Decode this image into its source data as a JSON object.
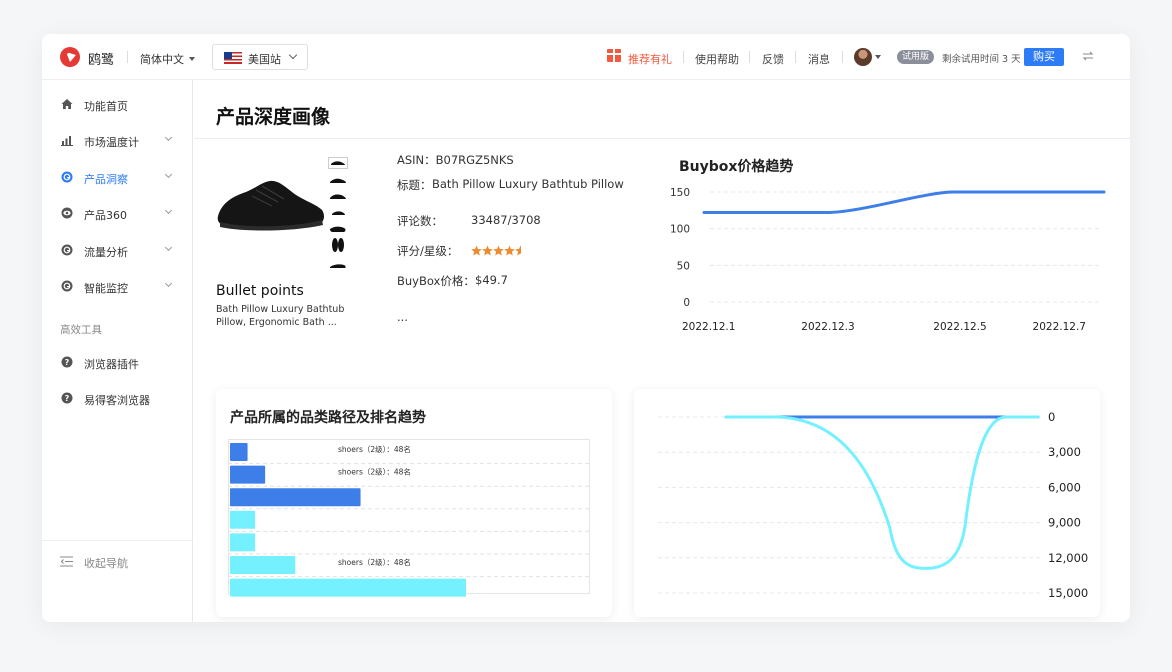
{
  "header": {
    "brand": "鸥鹭",
    "language": "简体中文",
    "site": "美国站",
    "recommend": "推荐有礼",
    "help": "使用帮助",
    "feedback": "反馈",
    "messages": "消息",
    "trial_badge": "试用版",
    "trial_remaining": "剩余试用时间 3 天",
    "buy": "购买"
  },
  "sidebar": {
    "items": [
      {
        "label": "功能首页",
        "icon": "home-icon"
      },
      {
        "label": "市场温度计",
        "icon": "bar-chart-icon"
      },
      {
        "label": "产品洞察",
        "icon": "insight-icon"
      },
      {
        "label": "产品360",
        "icon": "eye-icon"
      },
      {
        "label": "流量分析",
        "icon": "traffic-icon"
      },
      {
        "label": "智能监控",
        "icon": "monitor-icon"
      }
    ],
    "tools_label": "高效工具",
    "tools": [
      {
        "label": "浏览器插件",
        "icon": "help-icon"
      },
      {
        "label": "易得客浏览器",
        "icon": "help-icon"
      }
    ],
    "collapse": "收起导航"
  },
  "page": {
    "title": "产品深度画像"
  },
  "product": {
    "asin": "ASIN：B07RGZ5NKS",
    "title_label": "标题：",
    "title_value": "Bath Pillow Luxury Bathtub Pillow",
    "reviews_label": "评论数：",
    "reviews_value": "33487/3708",
    "rating_label": "评分/星级：",
    "rating_stars": 4.5,
    "buybox_label": "BuyBox价格：",
    "buybox_value": "$49.7",
    "ellipsis": "...",
    "bullet_title": "Bullet points",
    "bullet_text": "Bath Pillow Luxury Bathtub Pillow, Ergonomic Bath ..."
  },
  "colors": {
    "accent": "#2d7cf6",
    "line_blue": "#3d7ee8",
    "cyan": "#74f0ff",
    "star": "#f08a2e"
  },
  "chart_data": [
    {
      "type": "line",
      "title": "Buybox价格趋势",
      "x": [
        "2022.12.1",
        "2022.12.3",
        "2022.12.5",
        "2022.12.7"
      ],
      "y_ticks": [
        0,
        50,
        100,
        150
      ],
      "ylim": [
        0,
        150
      ],
      "series": [
        {
          "values": [
            122,
            122,
            150,
            150
          ]
        }
      ],
      "grid": true
    },
    {
      "type": "bar",
      "title": "产品所属的品类路径及排名趋势",
      "orientation": "horizontal",
      "values": [
        7,
        14,
        52,
        10,
        10,
        26,
        94
      ],
      "xlim": [
        0,
        143
      ],
      "bar_colors": [
        "#3d7ee8",
        "#3d7ee8",
        "#3d7ee8",
        "#74f0ff",
        "#74f0ff",
        "#74f0ff",
        "#74f0ff"
      ],
      "labels": [
        "shoers（2级）：48名",
        "shoers（2级）：48名",
        "",
        "",
        "",
        "shoers（2级）：48名",
        ""
      ],
      "grid": true
    },
    {
      "type": "line",
      "y_ticks": [
        "0",
        "3,000",
        "6,000",
        "9,000",
        "12,000",
        "15,000"
      ],
      "ylim": [
        0,
        15000
      ],
      "y_reversed": true,
      "grid": true,
      "series": [
        {
          "color": "#3d7ee8",
          "values": [
            0,
            0
          ]
        },
        {
          "color": "#74f0ff",
          "values": [
            0,
            12900,
            0
          ]
        }
      ]
    }
  ]
}
